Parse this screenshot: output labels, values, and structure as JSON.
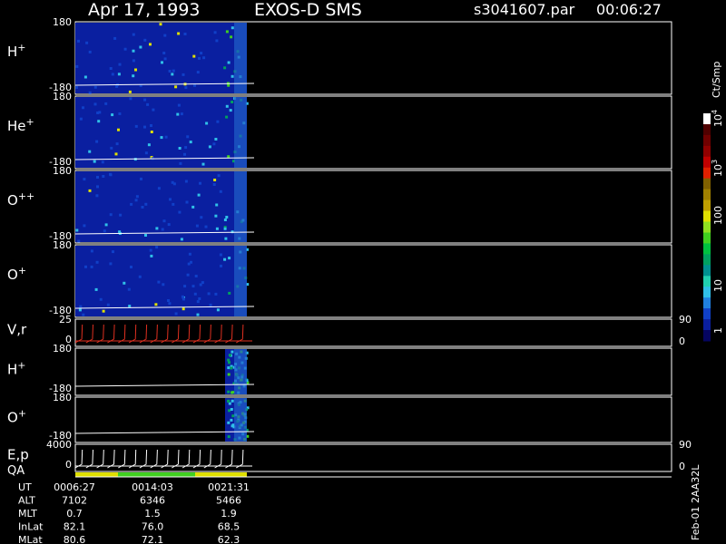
{
  "header": {
    "date": "Apr 17, 1993",
    "instrument": "EXOS-D SMS",
    "file": "s3041607.par",
    "time": "00:06:27"
  },
  "panels": [
    {
      "id": "h1",
      "label": "H",
      "sup": "+",
      "top": "180",
      "bottom": "-180",
      "right_top": "",
      "right_bottom": ""
    },
    {
      "id": "he",
      "label": "He",
      "sup": "+",
      "top": "180",
      "bottom": "-180",
      "right_top": "",
      "right_bottom": ""
    },
    {
      "id": "opp",
      "label": "O",
      "sup": "++",
      "top": "180",
      "bottom": "-180",
      "right_top": "",
      "right_bottom": ""
    },
    {
      "id": "op1",
      "label": "O",
      "sup": "+",
      "top": "180",
      "bottom": "-180",
      "right_top": "",
      "right_bottom": ""
    },
    {
      "id": "vr",
      "label": "V,r",
      "sup": "",
      "top": "25",
      "bottom": "0",
      "right_top": "90",
      "right_bottom": "0"
    },
    {
      "id": "h2",
      "label": "H",
      "sup": "+",
      "top": "180",
      "bottom": "-180",
      "right_top": "",
      "right_bottom": ""
    },
    {
      "id": "op2",
      "label": "O",
      "sup": "+",
      "top": "180",
      "bottom": "-180",
      "right_top": "",
      "right_bottom": ""
    },
    {
      "id": "ep",
      "label": "E,p",
      "sup": "",
      "top": "4000",
      "bottom": "0",
      "right_top": "90",
      "right_bottom": "0"
    }
  ],
  "qa_label": "QA",
  "orbit_table": {
    "rows": [
      {
        "label": "UT",
        "values": [
          "0006:27",
          "0014:03",
          "0021:31"
        ]
      },
      {
        "label": "ALT",
        "values": [
          "7102",
          "6346",
          "5466"
        ]
      },
      {
        "label": "MLT",
        "values": [
          "0.7",
          "1.5",
          "1.9"
        ]
      },
      {
        "label": "InLat",
        "values": [
          "82.1",
          "76.0",
          "68.5"
        ]
      },
      {
        "label": "MLat",
        "values": [
          "80.6",
          "72.1",
          "62.3"
        ]
      }
    ]
  },
  "colorbar": {
    "unit": "Ct/Smp",
    "labels": [
      "1",
      "10",
      "100",
      "10",
      "10"
    ],
    "label_sups": [
      "",
      "",
      "",
      "3",
      "4"
    ],
    "colors": [
      "#050560",
      "#0a1fa0",
      "#1040c8",
      "#2080e0",
      "#30c0e8",
      "#20d0b0",
      "#009090",
      "#00a060",
      "#00c040",
      "#40d020",
      "#90e020",
      "#e0e000",
      "#c0a000",
      "#a08000",
      "#806000",
      "#e02000",
      "#c00000",
      "#900000",
      "#700000",
      "#500000",
      "#ffffff"
    ]
  },
  "chart_data": {
    "type": "heatmap",
    "title": "Apr 17, 1993   EXOS-D SMS",
    "xlabel": "UT",
    "x_ticks": [
      "0006:27",
      "0014:03",
      "0021:31"
    ],
    "panels": [
      "H+",
      "He+",
      "O++",
      "O+",
      "V,r",
      "H+",
      "O+",
      "E,p"
    ],
    "ylim_angle": [
      -180,
      180
    ],
    "ylim_velocity": [
      0,
      25
    ],
    "ylim_energy": [
      0,
      4000
    ],
    "y2lim": [
      0,
      90
    ],
    "colorbar_range": [
      1,
      10000
    ],
    "colorbar_scale": "log",
    "data_extent_fraction": 0.27,
    "legend_placement": "right"
  }
}
